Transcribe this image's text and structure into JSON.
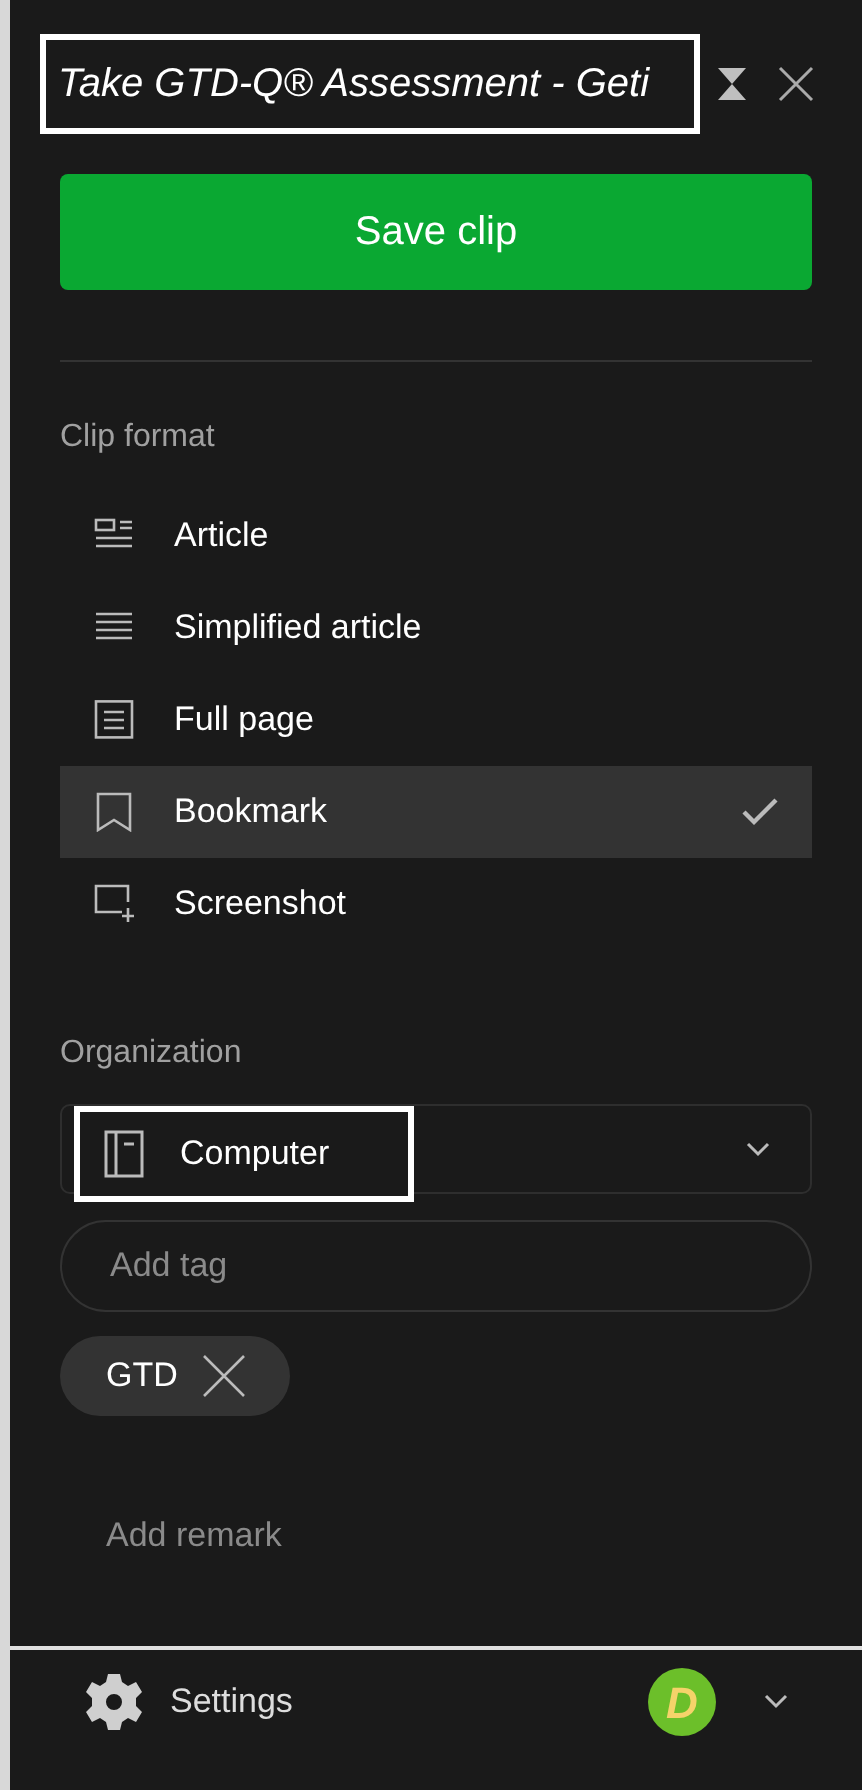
{
  "title": {
    "text": "Take GTD-Q® Assessment - Geti",
    "highlighted": true
  },
  "save_button": "Save clip",
  "clip_format": {
    "label": "Clip format",
    "items": [
      {
        "kind": "article",
        "label": "Article",
        "selected": false
      },
      {
        "kind": "simplified",
        "label": "Simplified article",
        "selected": false
      },
      {
        "kind": "fullpage",
        "label": "Full page",
        "selected": false
      },
      {
        "kind": "bookmark",
        "label": "Bookmark",
        "selected": true
      },
      {
        "kind": "screenshot",
        "label": "Screenshot",
        "selected": false
      }
    ]
  },
  "organization": {
    "label": "Organization",
    "notebook": {
      "text": "Computer",
      "highlighted": true
    },
    "tag_placeholder": "Add tag",
    "tags": [
      "GTD"
    ],
    "remark_placeholder": "Add remark"
  },
  "footer": {
    "settings": "Settings",
    "avatar_letter": "D"
  }
}
